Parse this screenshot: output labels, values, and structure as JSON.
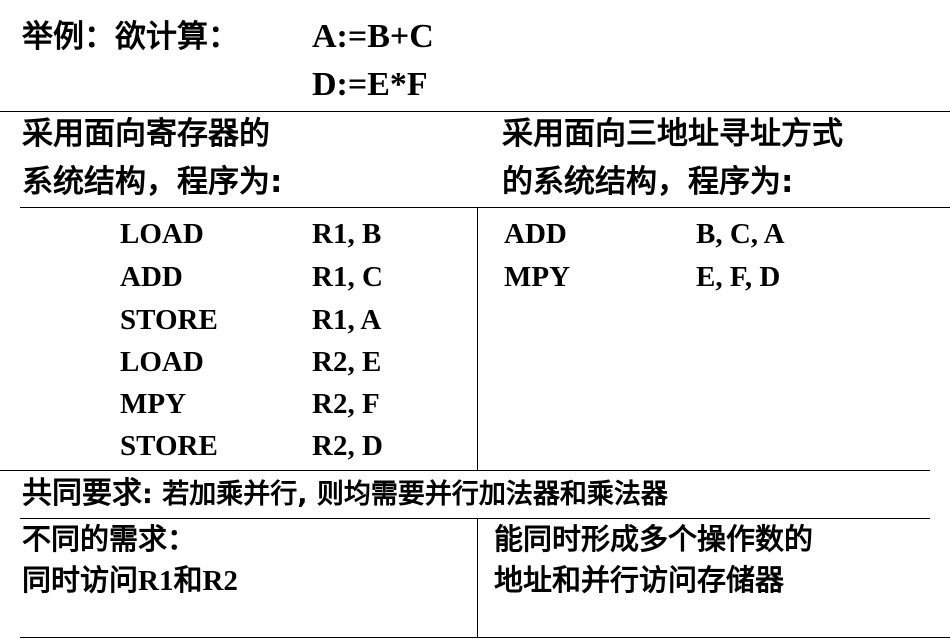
{
  "example": {
    "label": "举例：欲计算：",
    "expr1": "A:=B+C",
    "expr2": "D:=E*F"
  },
  "left_header": {
    "line1": "采用面向寄存器的",
    "line2": "系统结构，程序为:"
  },
  "right_header": {
    "line1": "采用面向三地址寻址方式",
    "line2": "的系统结构，程序为:"
  },
  "left_program": [
    {
      "op": "LOAD",
      "args": "R1, B"
    },
    {
      "op": "ADD",
      "args": "R1, C"
    },
    {
      "op": "STORE",
      "args": "R1, A"
    },
    {
      "op": "LOAD",
      "args": "R2, E"
    },
    {
      "op": "MPY",
      "args": "R2, F"
    },
    {
      "op": "STORE",
      "args": "R2, D"
    }
  ],
  "right_program": [
    {
      "op": "ADD",
      "args": "B, C, A"
    },
    {
      "op": "MPY",
      "args": "E, F, D"
    }
  ],
  "common": {
    "label": "共同要求",
    "text": ": 若加乘并行, 则均需要并行加法器和乘法器"
  },
  "diff_left": {
    "line1": "不同的需求：",
    "line2_prefix": "同时访问",
    "line2_reg1": "R1",
    "line2_mid": "和",
    "line2_reg2": "R2"
  },
  "diff_right": {
    "line1": "能同时形成多个操作数的",
    "line2": "地址和并行访问存储器"
  }
}
